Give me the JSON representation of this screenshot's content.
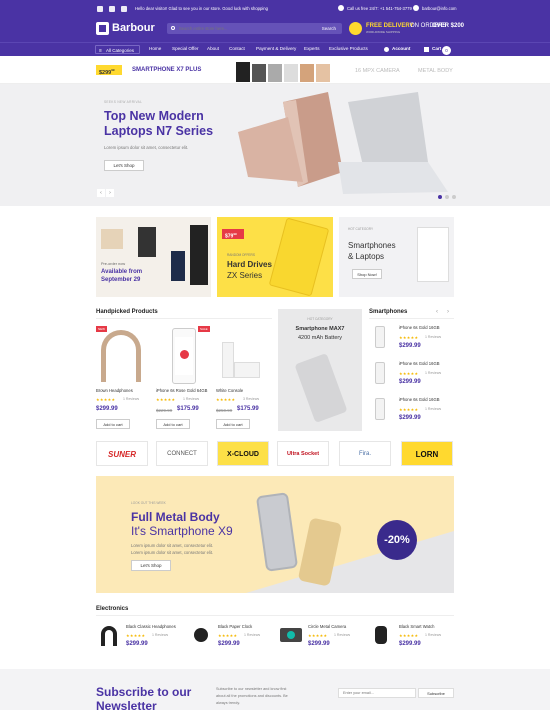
{
  "topbar": {
    "greeting": "Hello dear visitor! Glad to see you in our store. Good luck with shopping",
    "call": "Call us free 24/7: +1 541-754-3779",
    "email": "barbour@info.com"
  },
  "header": {
    "logo": "Barbour",
    "search_placeholder": "Search entire store here...",
    "search_button": "Search",
    "delivery_title": "FREE DELIVERY",
    "delivery_sub": "WORLDWIDE SHIPPING",
    "orders_prefix": "ON ORDERS",
    "orders_value": "OVER $200"
  },
  "nav": {
    "categories": "All Categories",
    "items": [
      "Home",
      "Special Offer",
      "About",
      "Contact",
      "Payment & Delivery",
      "Experts",
      "Exclusive Products"
    ],
    "account": "Account",
    "cart": "Cart",
    "cart_count": "0"
  },
  "promo": {
    "price": "$299",
    "price_sup": "99",
    "title": "SMARTPHONE X7 PLUS",
    "feature1": "16 MPX CAMERA",
    "feature2": "METAL BODY"
  },
  "hero": {
    "kicker": "SEEKS NEW ARRIVAL",
    "title1": "Top New Modern",
    "title2": "Laptops N7 Series",
    "desc": "Lorem ipsum dolor sit amet, consectetur elit.",
    "button": "Let's Shop"
  },
  "banners": {
    "b1_line1": "Pre-order now",
    "b1_line2": "Available from",
    "b1_line3": "September 29",
    "b2_price": "$79",
    "b2_price_sup": "99",
    "b2_kicker": "RANDOM OFFERS",
    "b2_title1": "Hard Drives",
    "b2_title2": "ZX Series",
    "b3_kicker": "HOT CATEGORY",
    "b3_title1": "Smartphones",
    "b3_title2": "& Laptops",
    "b3_button": "Shop Now!"
  },
  "handpicked": {
    "title": "Handpicked Products",
    "products": [
      {
        "name": "Brown Headphones",
        "old": "",
        "price": "$299.99",
        "reviews": "1 Reviews",
        "cart": "Add to cart",
        "badge": "NEW"
      },
      {
        "name": "iPhone 6s Rose Gold 64GB",
        "old": "$229.99",
        "price": "$175.99",
        "reviews": "1 Reviews",
        "cart": "Add to cart",
        "badge": "SALE"
      },
      {
        "name": "White Console",
        "old": "$250.99",
        "price": "$175.99",
        "reviews": "3 Reviews",
        "cart": "Add to cart",
        "badge": ""
      }
    ]
  },
  "maxpromo": {
    "kicker": "HOT CATEGORY",
    "title": "Smartphone MAX7",
    "sub": "4200 mAh Battery"
  },
  "smartphones": {
    "title": "Smartphones",
    "items": [
      {
        "name": "iPhone 6s Gold 16GB",
        "reviews": "1 Reviews",
        "price": "$299.99"
      },
      {
        "name": "iPhone 6s Gold 16GB",
        "reviews": "1 Reviews",
        "price": "$299.99"
      },
      {
        "name": "iPhone 6s Gold 16GB",
        "reviews": "1 Reviews",
        "price": "$299.99"
      }
    ]
  },
  "brands": [
    "SUNER",
    "CONNECT",
    "X-CLOUD",
    "Ultra Socket",
    "Fira.",
    "LORN"
  ],
  "metal": {
    "kicker": "LOOK OUT THIS WEEK",
    "title1": "Full Metal Body",
    "title2": "It's Smartphone X9",
    "desc1": "Lorem ipsum dolor sit amet, consectetur elit.",
    "desc2": "Lorem ipsum dolor sit amet, consectetur elit.",
    "button": "Let's Shop",
    "discount": "-20%"
  },
  "electronics": {
    "title": "Electronics",
    "items": [
      {
        "name": "Black Classic Headphones",
        "reviews": "1 Reviews",
        "price": "$299.99"
      },
      {
        "name": "Black Paper Clock",
        "reviews": "1 Reviews",
        "price": "$299.99"
      },
      {
        "name": "Circle Metal Camera",
        "reviews": "1 Reviews",
        "price": "$299.99"
      },
      {
        "name": "Black Smart Watch",
        "reviews": "1 Reviews",
        "price": "$299.99"
      }
    ]
  },
  "newsletter": {
    "title1": "Subscribe to our",
    "title2": "Newsletter",
    "desc1": "Subscribe to our newsletter and know first",
    "desc2": "about all the promotions and discounts. Be",
    "desc3": "always trendy.",
    "placeholder": "Enter your email...",
    "button": "Subscribe"
  },
  "colors": {
    "primary": "#4a33a4",
    "accent": "#ffd92f",
    "price": "#4a33a4"
  }
}
